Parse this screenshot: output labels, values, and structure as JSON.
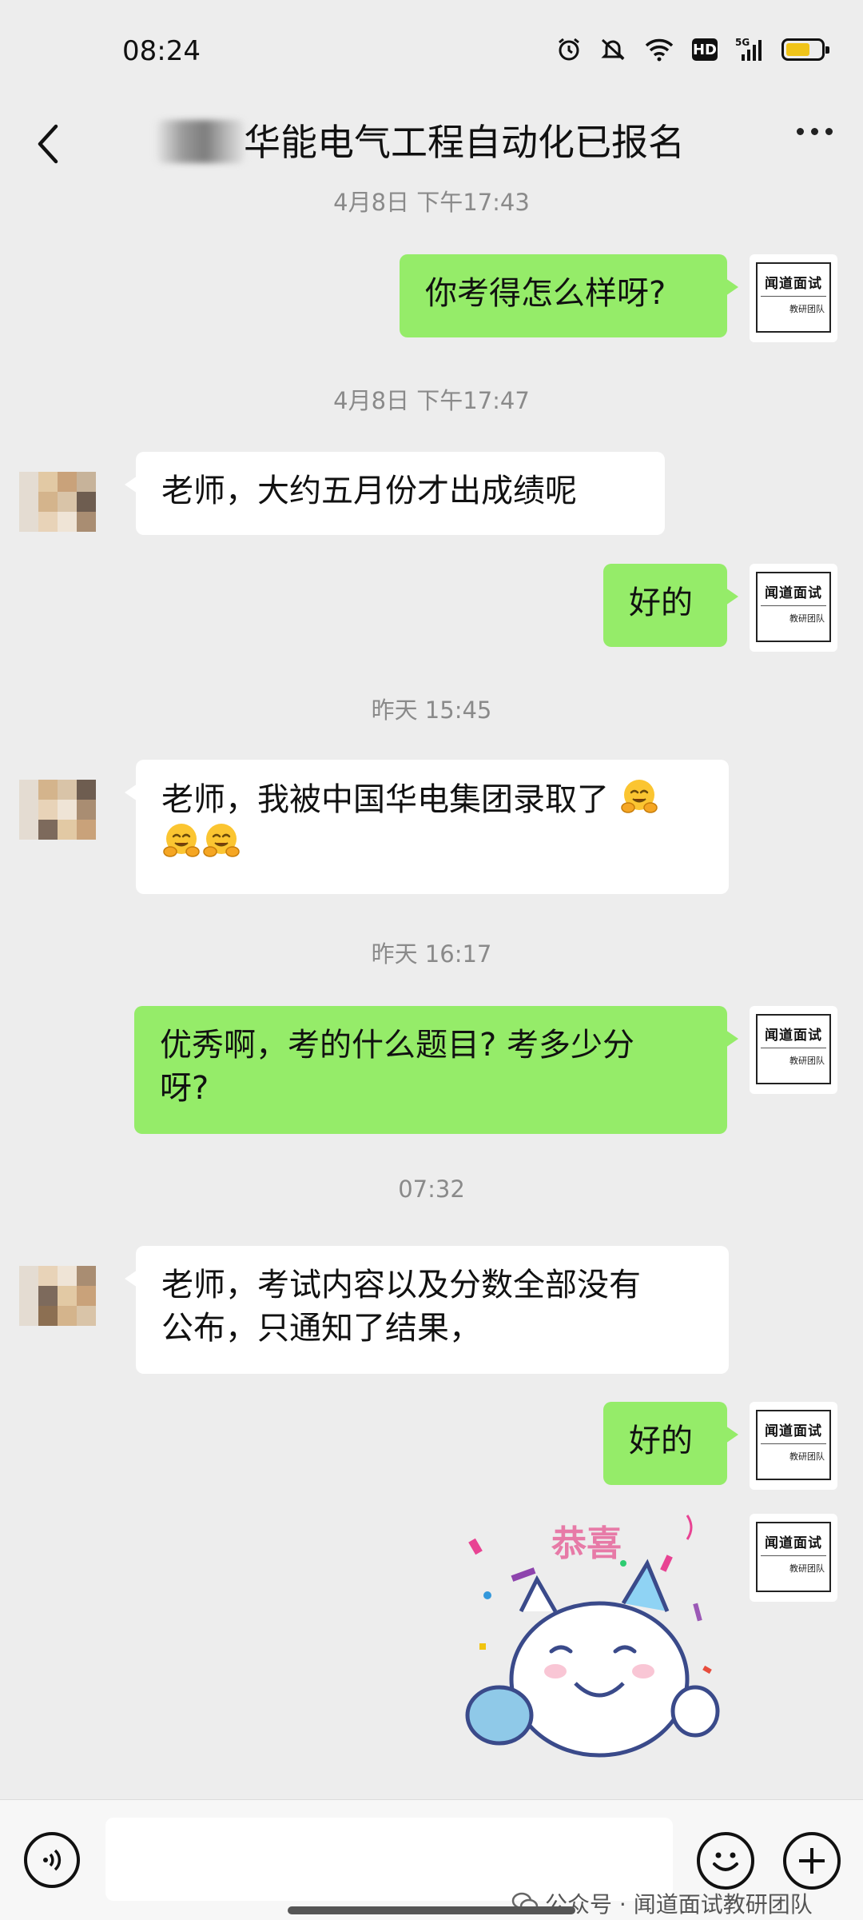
{
  "status_bar": {
    "time": "08:24",
    "network": "5G",
    "hd_label": "HD",
    "battery_level_percent": 70
  },
  "header": {
    "title": "华能电气工程自动化已报名"
  },
  "self_avatar": {
    "line1": "闻道面试",
    "line2": "教研团队"
  },
  "messages": [
    {
      "kind": "timestamp",
      "text": "4月8日 下午17:43"
    },
    {
      "kind": "outgoing",
      "text": "你考得怎么样呀?"
    },
    {
      "kind": "timestamp",
      "text": "4月8日 下午17:47"
    },
    {
      "kind": "incoming",
      "text": "老师，大约五月份才出成绩呢"
    },
    {
      "kind": "outgoing",
      "text": "好的"
    },
    {
      "kind": "timestamp",
      "text": "昨天 15:45"
    },
    {
      "kind": "incoming",
      "text": "老师，我被中国华电集团录取了",
      "emoji": "hugging-face"
    },
    {
      "kind": "timestamp",
      "text": "昨天 16:17"
    },
    {
      "kind": "outgoing",
      "line1": "优秀啊，考的什么题目? 考多少分",
      "line2": "呀?"
    },
    {
      "kind": "timestamp",
      "text": "07:32"
    },
    {
      "kind": "incoming",
      "line1": "老师，考试内容以及分数全部没有",
      "line2": "公布，只通知了结果，"
    },
    {
      "kind": "outgoing",
      "text": "好的"
    },
    {
      "kind": "sticker",
      "caption": "恭喜"
    }
  ],
  "input_bar": {
    "placeholder": ""
  },
  "watermark": {
    "text": "公众号 · 闻道面试教研团队"
  }
}
